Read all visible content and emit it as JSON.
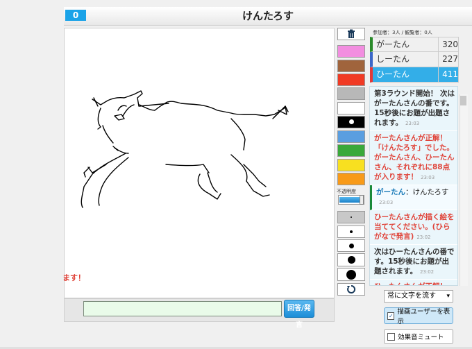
{
  "header": {
    "score": "0",
    "title": "けんたろす"
  },
  "participants_text": "参加者：3人 / 観覧者：0人",
  "players": [
    {
      "name": "がーたん",
      "score": "320",
      "color": "#2a8a2a",
      "highlight": false
    },
    {
      "name": "しーたん",
      "score": "227",
      "color": "#3a66c8",
      "highlight": false
    },
    {
      "name": "ひーたん",
      "score": "411",
      "color": "#e03a3a",
      "highlight": true
    }
  ],
  "chat": [
    {
      "text": "第3ラウンド開始！ 次はがーたんさんの番です。15秒後にお題が出題されます。",
      "time": "23:03",
      "color": "#333333",
      "bar": ""
    },
    {
      "text": "がーたんさんが正解！「けんたろす」でした。がーたんさん、ひーたんさん、それぞれに88点が入ります！",
      "time": "23:03",
      "color": "#e0443a",
      "bar": ""
    },
    {
      "name": "がーたん",
      "sep": "：",
      "text": "けんたろす",
      "time": "23:03",
      "color": "#1a1a1a",
      "bar": "#1a8a3a"
    },
    {
      "text": "ひーたんさんが描く絵を当ててください。(ひらがなで発言)",
      "time": "23:02",
      "color": "#e0443a",
      "bar": ""
    },
    {
      "text": "次はひーたんさんの番です。15秒後にお題が出題されます。",
      "time": "23:02",
      "color": "#333333",
      "bar": ""
    },
    {
      "text": "ひーたんさんが正解！",
      "time": "",
      "color": "#e0443a",
      "bar": ""
    }
  ],
  "left_message": "ます！",
  "answer": {
    "placeholder": "",
    "button_label": "回答/発言"
  },
  "tools": {
    "opacity_label": "不透明度",
    "colors": [
      "#f28ee0",
      "#a0643c",
      "#f03a24",
      "#b8b8b8",
      "#ffffff",
      "#000000",
      "#5a9ee0",
      "#3aa83a",
      "#f8e020",
      "#f89a18"
    ]
  },
  "options": {
    "stream_select": "常に文字を流す",
    "show_drawer": "描画ユーザーを表示",
    "show_drawer_checked": true,
    "mute": "効果音ミュート",
    "mute_checked": false
  }
}
